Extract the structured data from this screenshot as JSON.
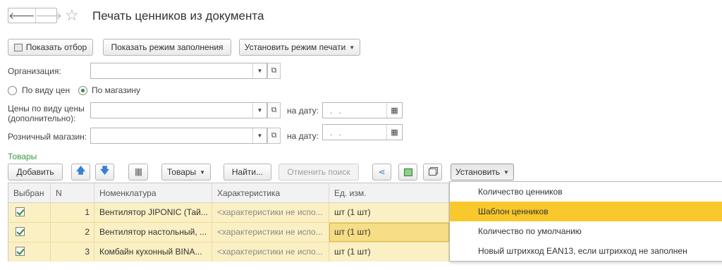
{
  "window": {
    "title": "Печать ценников из документа",
    "nav_back": "🡐",
    "nav_forward": "🡒",
    "star": "☆"
  },
  "toolbar": {
    "show_filter": "Показать отбор",
    "show_fill_mode": "Показать режим заполнения",
    "set_print_mode": "Установить режим печати"
  },
  "form": {
    "organization_label": "Организация:",
    "organization_value": "",
    "radio_by_price_type": "По виду цен",
    "radio_by_store": "По магазину",
    "radio_selected": "По магазину",
    "prices_label_line1": "Цены по виду цены",
    "prices_label_line2": "(дополнительно):",
    "prices_value": "",
    "on_date_label": "на дату:",
    "date_placeholder": ". .",
    "store_label": "Розничный магазин:",
    "store_value": "",
    "on_date_label_2": "на дату:",
    "date_placeholder_2": ". ."
  },
  "goods": {
    "section_title": "Товары",
    "add_button": "Добавить",
    "move_up_icon": "arrow-up",
    "move_down_icon": "arrow-down",
    "barcode_icon": "barcode",
    "goods_button": "Товары",
    "find_button": "Найти...",
    "cancel_search_button": "Отменить поиск",
    "set_button": "Установить",
    "columns": [
      "Выбран",
      "N",
      "Номенклатура",
      "Характеристика",
      "Ед. изм."
    ],
    "rows": [
      {
        "selected": true,
        "n": "1",
        "item": "Вентилятор JIPONIC (Тай...",
        "characteristic": "<характеристики не испо...",
        "unit": "шт (1 шт)"
      },
      {
        "selected": true,
        "n": "2",
        "item": "Вентилятор настольный, ...",
        "characteristic": "<характеристики не испо...",
        "unit": "шт (1 шт)"
      },
      {
        "selected": true,
        "n": "3",
        "item": "Комбайн кухонный BINA...",
        "characteristic": "<характеристики не испо...",
        "unit": "шт (1 шт)"
      }
    ]
  },
  "set_menu": {
    "items": [
      "Количество ценников",
      "Шаблон ценников",
      "Количество по умолчанию",
      "Новый штрихкод EAN13, если штрихкод не заполнен"
    ],
    "highlighted_index": 1,
    "highlight_color": "#f8c82c"
  }
}
